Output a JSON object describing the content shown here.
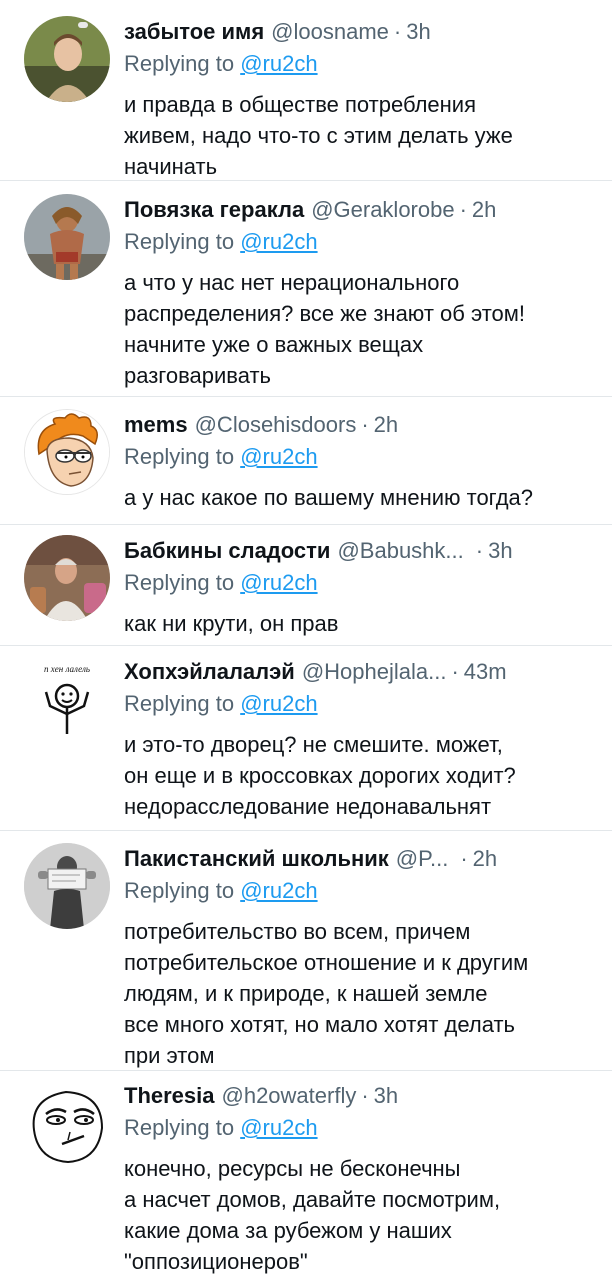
{
  "replying_prefix": "Replying to",
  "mention": "@ru2ch",
  "colors": {
    "link": "#1d9bf0",
    "muted": "#536471",
    "text": "#0f1419"
  },
  "replies": [
    {
      "avatar_icon": "man-in-car-avatar",
      "name": "забытое имя",
      "handle": "@loosname",
      "time": "3h",
      "text": "и правда в обществе потребления\nживем, надо что-то с этим делать уже\nначинать"
    },
    {
      "avatar_icon": "warrior-statue-avatar",
      "name": "Повязка геракла",
      "handle": "@Geraklorobe",
      "time": "2h",
      "text": "а что у нас нет нерационального\nраспределения? все же знают об этом!\nначните уже о важных вещах\nразговаривать"
    },
    {
      "avatar_icon": "cartoon-fry-avatar",
      "name": "mems",
      "handle": "@Closehisdoors",
      "time": "2h",
      "text": "а у нас какое по вашему мнению тогда?"
    },
    {
      "avatar_icon": "old-man-photo-avatar",
      "name": "Бабкины сладости",
      "handle": "@Babushk...",
      "time": "3h",
      "text": "как ни крути, он прав"
    },
    {
      "avatar_icon": "stick-figure-avatar",
      "avatar_caption": "п хен лалель",
      "name": "Хопхэйлалалэй",
      "handle": "@Hophejlala...",
      "time": "43m",
      "text": "и это-то дворец? не смешите. может,\nон еще и в кроссовках дорогих ходит?\nнедорасследование недонавальнят"
    },
    {
      "avatar_icon": "person-with-sign-avatar",
      "name": "Пакистанский школьник",
      "handle": "@P...",
      "time": "2h",
      "text": "потребительство во всем, причем\nпотребительское отношение и к другим\nлюдям, и к природе, к нашей земле\nвсе много хотят, но мало хотят делать\nпри этом"
    },
    {
      "avatar_icon": "meme-face-avatar",
      "name": "Theresia",
      "handle": "@h2owaterfly",
      "time": "3h",
      "text": "конечно, ресурсы не бесконечны\nа насчет домов, давайте посмотрим,\nкакие дома за рубежом у наших\n\"оппозиционеров\""
    }
  ]
}
